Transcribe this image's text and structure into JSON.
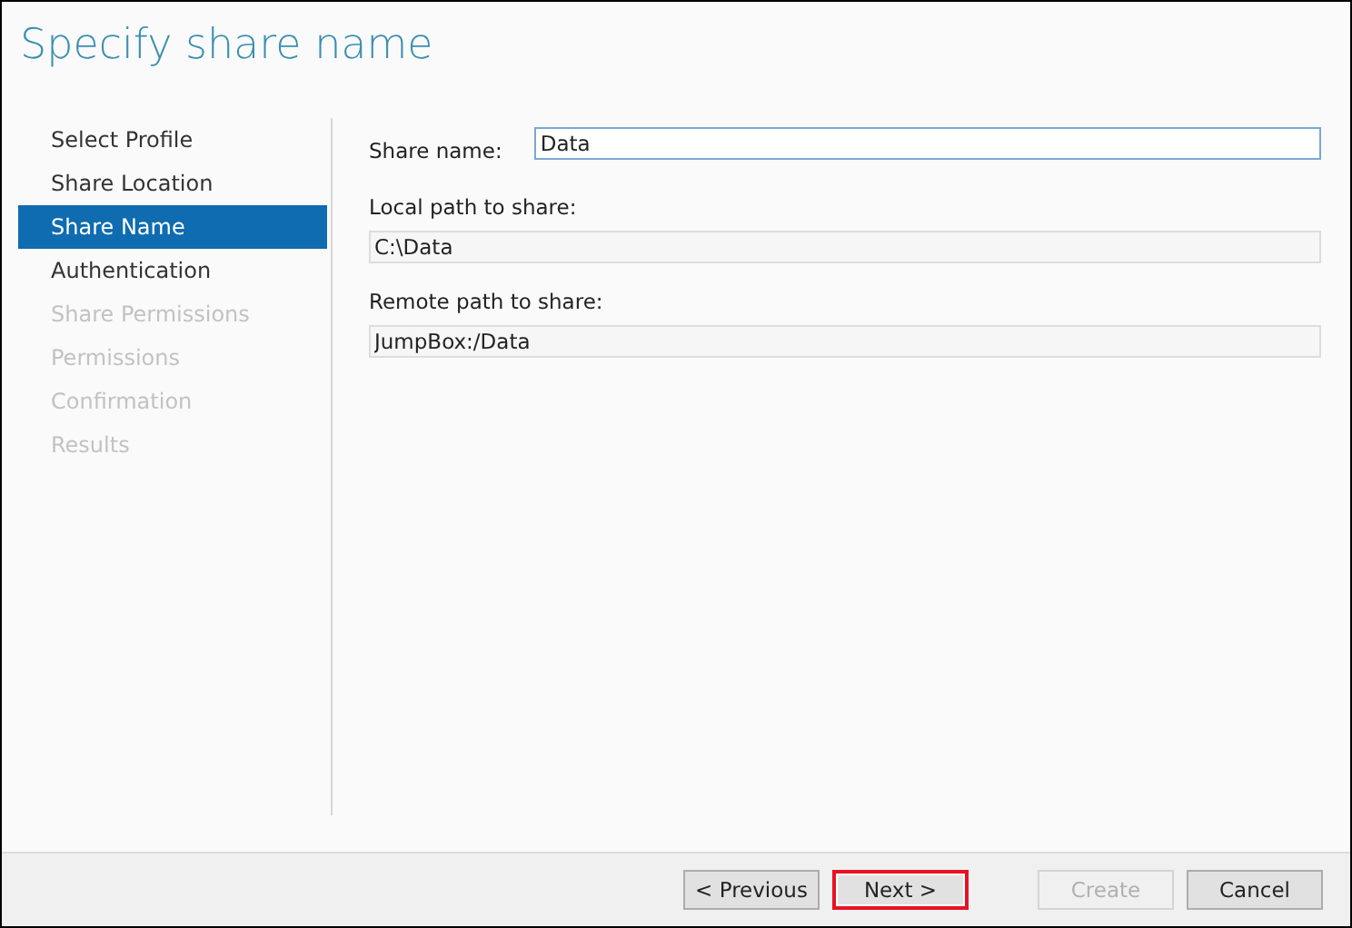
{
  "title": "Specify share name",
  "nav": [
    {
      "label": "Select Profile",
      "selected": false,
      "disabled": false
    },
    {
      "label": "Share Location",
      "selected": false,
      "disabled": false
    },
    {
      "label": "Share Name",
      "selected": true,
      "disabled": false
    },
    {
      "label": "Authentication",
      "selected": false,
      "disabled": false
    },
    {
      "label": "Share Permissions",
      "selected": false,
      "disabled": true
    },
    {
      "label": "Permissions",
      "selected": false,
      "disabled": true
    },
    {
      "label": "Confirmation",
      "selected": false,
      "disabled": true
    },
    {
      "label": "Results",
      "selected": false,
      "disabled": true
    }
  ],
  "share_name": {
    "label": "Share name:",
    "value": "Data",
    "focused": true
  },
  "fields": [
    {
      "label": "Local path to share:",
      "value": "C:\\Data",
      "readonly": true
    },
    {
      "label": "Remote path to share:",
      "value": "JumpBox:/Data",
      "readonly": true
    }
  ],
  "buttons": [
    {
      "label": "< Previous",
      "disabled": false,
      "highlighted": false
    },
    {
      "label": "Next >",
      "disabled": false,
      "highlighted": true
    },
    {
      "label": "Create",
      "disabled": true,
      "highlighted": false
    },
    {
      "label": "Cancel",
      "disabled": false,
      "highlighted": false
    }
  ]
}
